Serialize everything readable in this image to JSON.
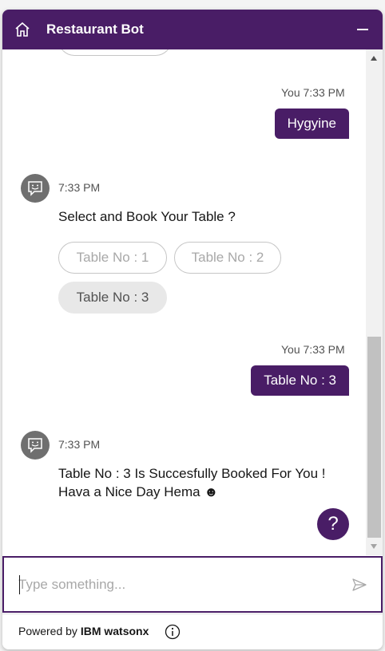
{
  "header": {
    "title": "Restaurant Bot"
  },
  "conversation": {
    "user_msg_1": {
      "time": "You 7:33 PM",
      "text": "Hygyine"
    },
    "bot_msg_1": {
      "time": "7:33 PM",
      "text": "Select and Book Your Table ?",
      "options": [
        "Table No : 1",
        "Table No : 2",
        "Table No : 3"
      ],
      "selected": "Table No : 3"
    },
    "user_msg_2": {
      "time": "You 7:33 PM",
      "text": "Table No : 3"
    },
    "bot_msg_2": {
      "time": "7:33 PM",
      "line1": "Table No : 3 Is Succesfully Booked For You !",
      "line2": "Hava a Nice Day Hema ☻"
    }
  },
  "help_button": {
    "label": "?"
  },
  "input": {
    "placeholder": "Type something...",
    "value": ""
  },
  "footer": {
    "powered_prefix": "Powered by",
    "brand": "IBM watsonx"
  },
  "colors": {
    "brand": "#491d66",
    "avatar": "#6f6f6f",
    "chip_border": "#c6c6c6"
  },
  "icons": {
    "home": "home-icon",
    "minimize": "minimize-icon",
    "bot": "bot-avatar-icon",
    "send": "send-icon",
    "info": "info-icon",
    "help": "help-icon"
  }
}
